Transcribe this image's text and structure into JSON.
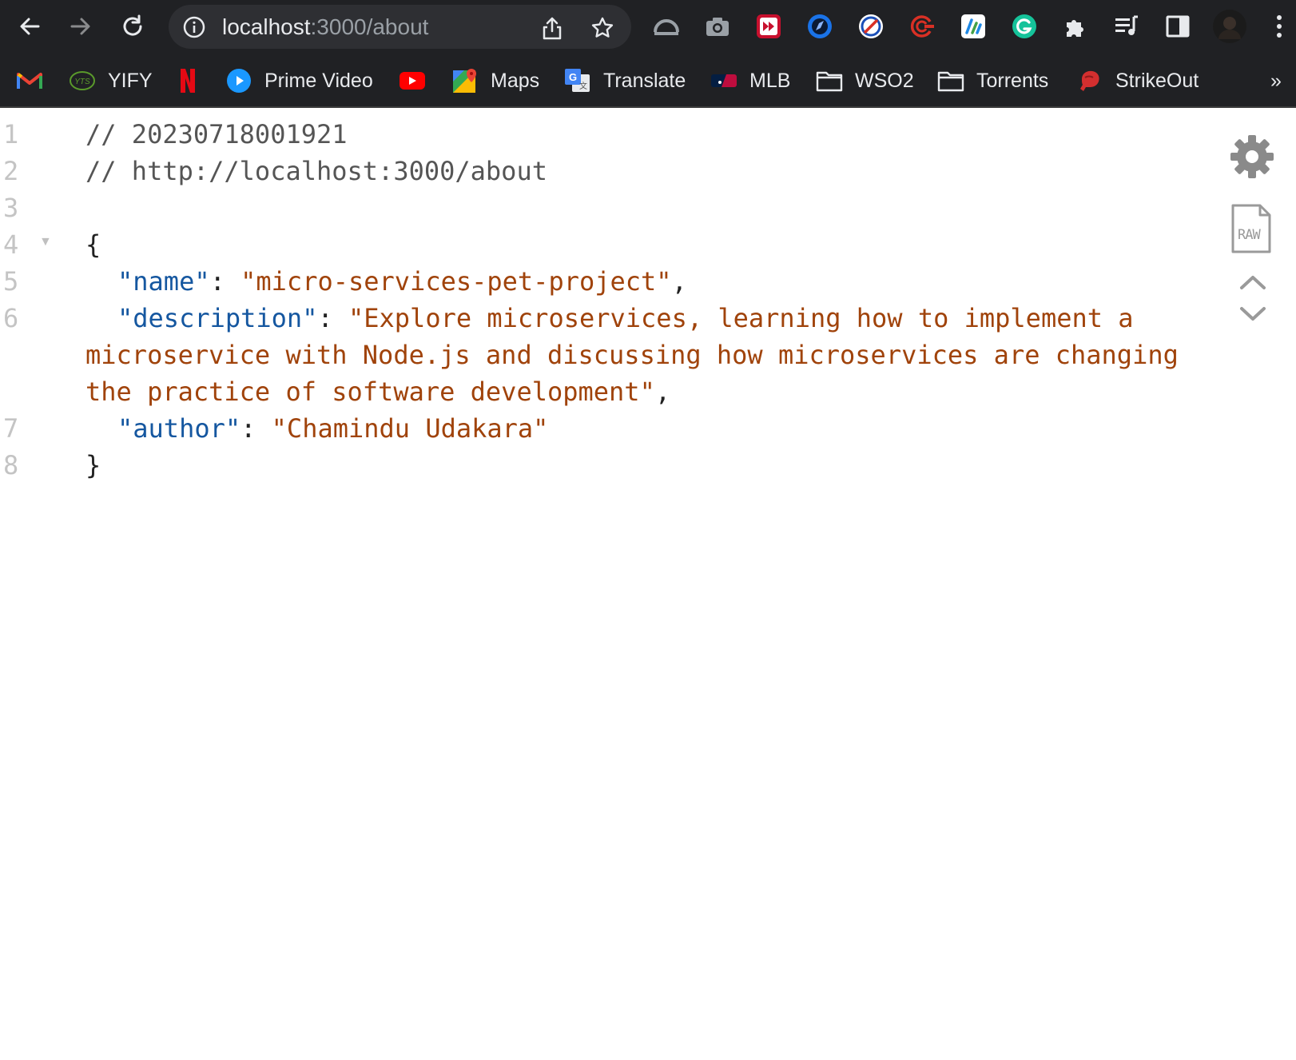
{
  "browser": {
    "url_host": "localhost",
    "url_rest": ":3000/about",
    "icons": {
      "back": "back-arrow-icon",
      "forward": "forward-arrow-icon",
      "reload": "reload-icon",
      "info": "info-icon",
      "share": "share-icon",
      "bookmark": "star-icon",
      "extensions": "puzzle-icon",
      "reading_list": "reading-list-icon",
      "side_panel": "side-panel-icon",
      "menu": "kebab-menu-icon"
    }
  },
  "bookmarks": [
    {
      "label": "",
      "icon": "gmail-icon"
    },
    {
      "label": "YIFY",
      "icon": "yts-icon"
    },
    {
      "label": "",
      "icon": "netflix-icon"
    },
    {
      "label": "Prime Video",
      "icon": "prime-video-icon"
    },
    {
      "label": "",
      "icon": "youtube-icon"
    },
    {
      "label": "Maps",
      "icon": "maps-icon"
    },
    {
      "label": "Translate",
      "icon": "translate-icon"
    },
    {
      "label": "MLB",
      "icon": "mlb-icon"
    },
    {
      "label": "WSO2",
      "icon": "folder-icon"
    },
    {
      "label": "Torrents",
      "icon": "folder-icon"
    },
    {
      "label": "StrikeOut",
      "icon": "boxing-glove-icon"
    }
  ],
  "bookmarks_overflow": "»",
  "json_viewer": {
    "line_numbers": [
      "1",
      "2",
      "3",
      "4",
      "5",
      "6",
      "7",
      "8"
    ],
    "comment_timestamp": "// 20230718001921",
    "comment_url": "// http://localhost:3000/about",
    "open_brace": "{",
    "close_brace": "}",
    "fields": {
      "name_key": "\"name\"",
      "name_value": "\"micro-services-pet-project\"",
      "description_key": "\"description\"",
      "description_value": "\"Explore microservices, learning how to implement a microservice with Node.js and discussing how microservices are changing the practice of software development\"",
      "author_key": "\"author\"",
      "author_value": "\"Chamindu Udakara\""
    },
    "raw_label": "RAW",
    "colors": {
      "key": "#1557a0",
      "string": "#a0430b",
      "comment": "#555555"
    }
  }
}
